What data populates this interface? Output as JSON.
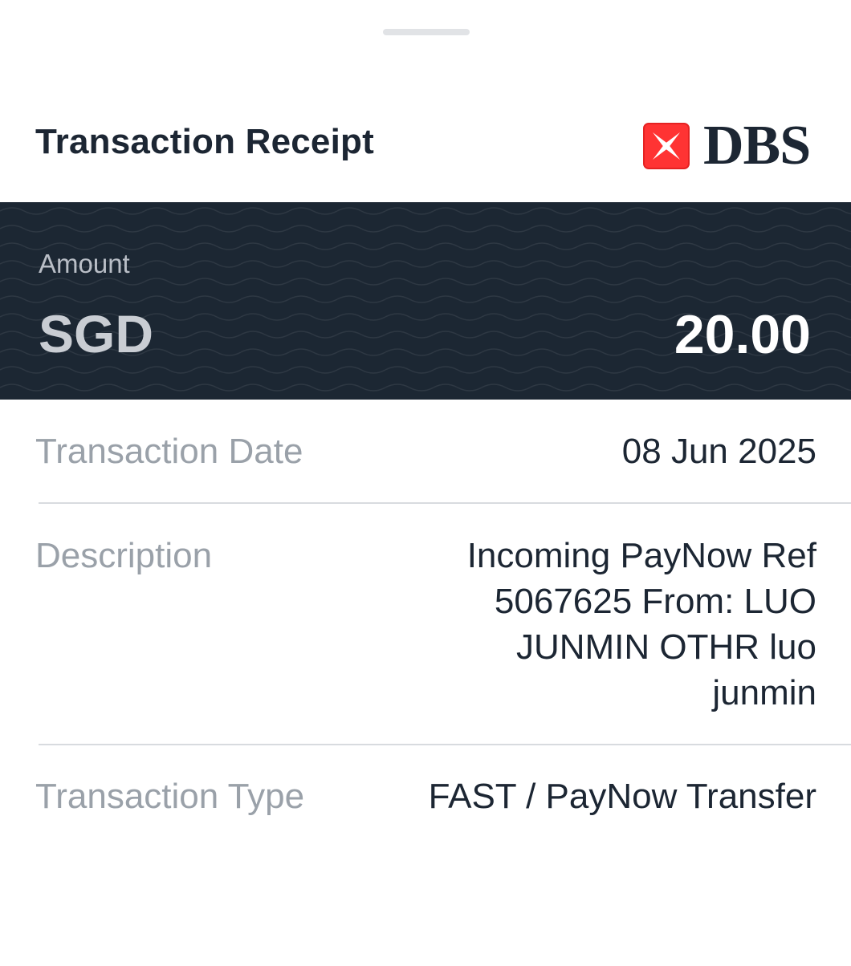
{
  "receipt": {
    "title": "Transaction Receipt",
    "logo": {
      "text": "DBS",
      "icon": "dbs-star-icon",
      "mark_color": "#ff3333"
    },
    "amount": {
      "label": "Amount",
      "currency": "SGD",
      "value": "20.00"
    },
    "details": [
      {
        "label": "Transaction Date",
        "value": "08 Jun 2025"
      },
      {
        "label": "Description",
        "value_lines": [
          "Incoming PayNow Ref",
          "5067625 From: LUO",
          "JUNMIN OTHR luo",
          "junmin"
        ]
      },
      {
        "label": "Transaction Type",
        "value": "FAST / PayNow Transfer"
      }
    ]
  },
  "colors": {
    "panel_background": "#1c2733",
    "text_primary": "#1c2633",
    "text_muted": "#9aa1a9"
  }
}
